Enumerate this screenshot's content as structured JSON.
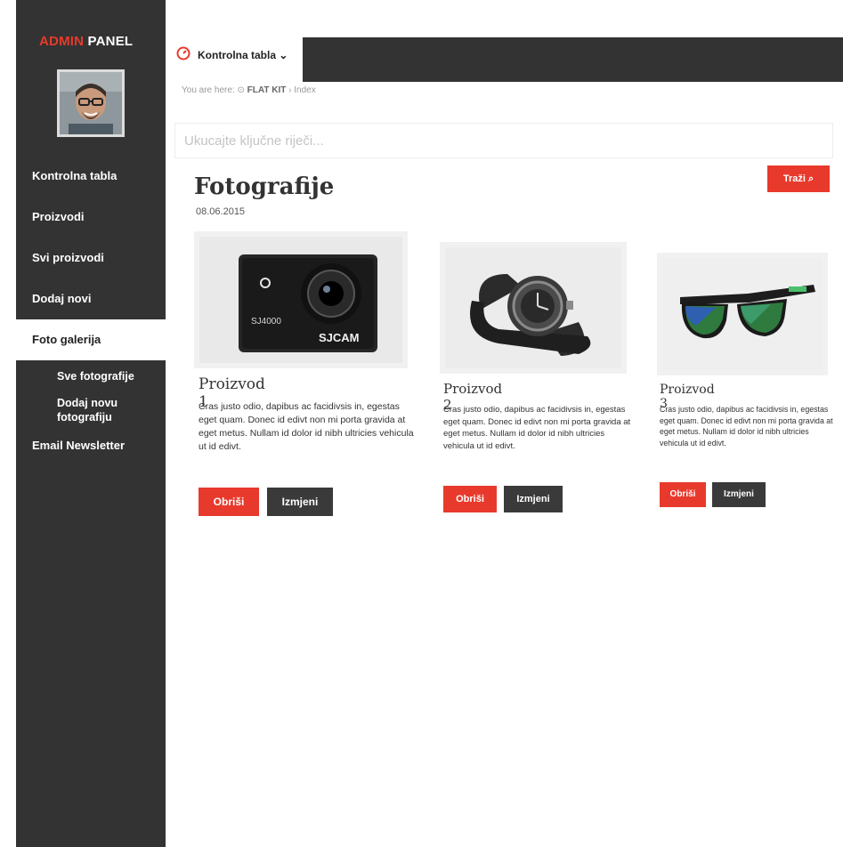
{
  "brand": {
    "part1": "ADMIN",
    "part2": "PANEL"
  },
  "sidebar": {
    "items": [
      {
        "label": "Kontrolna tabla"
      },
      {
        "label": "Proizvodi"
      },
      {
        "label": "Svi proizvodi"
      },
      {
        "label": "Dodaj novi"
      },
      {
        "label": "Foto galerija"
      }
    ],
    "subitems": [
      {
        "label": "Sve fotografije"
      },
      {
        "label": "Dodaj novu fotografiju"
      }
    ],
    "email_label": "Email Newsletter"
  },
  "topbar": {
    "tab_label": "Kontrolna tabla"
  },
  "breadcrumb": {
    "prefix": "You are here:",
    "site": "FLAT KIT",
    "page": "Index"
  },
  "search": {
    "placeholder": "Ukucajte ključne riječi...",
    "button_label": "Traži"
  },
  "page": {
    "title": "Fotografije",
    "date": "08.06.2015"
  },
  "products": [
    {
      "name": "Proizvod 1",
      "description": "Cras justo odio, dapibus ac facidivsis in, egestas eget quam. Donec id edivt non mi porta gravida at eget metus. Nullam id dolor id nibh ultricies vehicula ut id edivt.",
      "delete_label": "Obriši",
      "edit_label": "Izmjeni",
      "image_icon": "action-camera",
      "camera_brand": "SJCAM",
      "camera_model": "SJ4000"
    },
    {
      "name": "Proizvod 2",
      "description": "Cras justo odio, dapibus ac facidivsis in, egestas eget quam. Donec id edivt non mi porta gravida at eget metus. Nullam id dolor id nibh ultricies vehicula ut id edivt.",
      "delete_label": "Obriši",
      "edit_label": "Izmjeni",
      "image_icon": "wristwatch"
    },
    {
      "name": "Proizvod 3",
      "description": "Cras justo odio, dapibus ac facidivsis in, egestas eget quam. Donec id edivt non mi porta gravida at eget metus. Nullam id dolor id nibh ultricies vehicula ut id edivt.",
      "delete_label": "Obriši",
      "edit_label": "Izmjeni",
      "image_icon": "sunglasses"
    }
  ],
  "colors": {
    "accent": "#e83a2c",
    "sidebar": "#333333",
    "dark_button": "#3a3a3a"
  }
}
